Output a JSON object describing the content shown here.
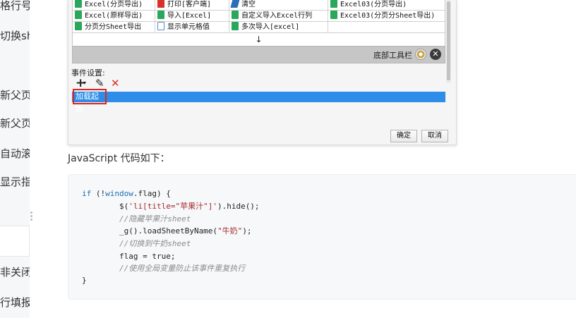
{
  "sidebar": {
    "items": [
      "格行号",
      "切换she",
      "新父页面",
      "新父页面",
      "自动滚动",
      "显示指定",
      "非关闭窗",
      "行填报"
    ]
  },
  "designer": {
    "grid": {
      "rows": [
        [
          {
            "icon": "excel-icon",
            "label": "Excel(分页导出)"
          },
          {
            "icon": "print-icon",
            "label": "打印[客户端]"
          },
          {
            "icon": "eraser-icon",
            "label": "清空"
          },
          {
            "icon": "excel-icon",
            "label": "Excel03(分页导出)"
          }
        ],
        [
          {
            "icon": "excel-icon",
            "label": "Excel(原样导出)"
          },
          {
            "icon": "excel-icon",
            "label": "导入[Excel]"
          },
          {
            "icon": "excel-icon",
            "label": "自定义导入Excel行列"
          },
          {
            "icon": "excel-icon",
            "label": "Excel03(分页分Sheet导出)"
          }
        ],
        [
          {
            "icon": "excel-icon",
            "label": "分页分Sheet导出"
          },
          {
            "icon": "cell-icon",
            "label": "显示单元格值"
          },
          {
            "icon": "excel-icon",
            "label": "多次导入[excel]"
          },
          {
            "icon": "",
            "label": ""
          }
        ]
      ]
    },
    "arrow": "↓",
    "bottom_toolbar_label": "底部工具栏",
    "event_settings_label": "事件设置:",
    "event_tools": {
      "add": "+",
      "add_dropdown": "▾",
      "edit": "✎",
      "delete": "✕"
    },
    "event_item": "加载起始",
    "confirm_label": "确定",
    "cancel_label": "取消",
    "close_glyph": "✕"
  },
  "content": {
    "js_caption": "JavaScript 代码如下："
  },
  "code": {
    "l1_kw1": "if",
    "l1_a": " (!",
    "l1_kw2": "window",
    "l1_b": ".flag) {",
    "l2_a": "        $(",
    "l2_str": "'li[title=\"苹果汁\"]'",
    "l2_b": ").hide();",
    "l3_cmt": "        //隐藏苹果汁sheet",
    "l4_a": "        _g().loadSheetByName(",
    "l4_str": "\"牛奶\"",
    "l4_b": ");",
    "l5_cmt": "        //切换到牛奶sheet",
    "l6": "        flag = true;",
    "l7_cmt": "        //使用全局变量防止该事件重复执行",
    "l8": "}"
  },
  "colors": {
    "keyword": "#1a6fb5",
    "string": "#a32c2c",
    "comment": "#8b8b8b",
    "selection": "#2e8de8",
    "highlight_border": "#e0241b"
  }
}
